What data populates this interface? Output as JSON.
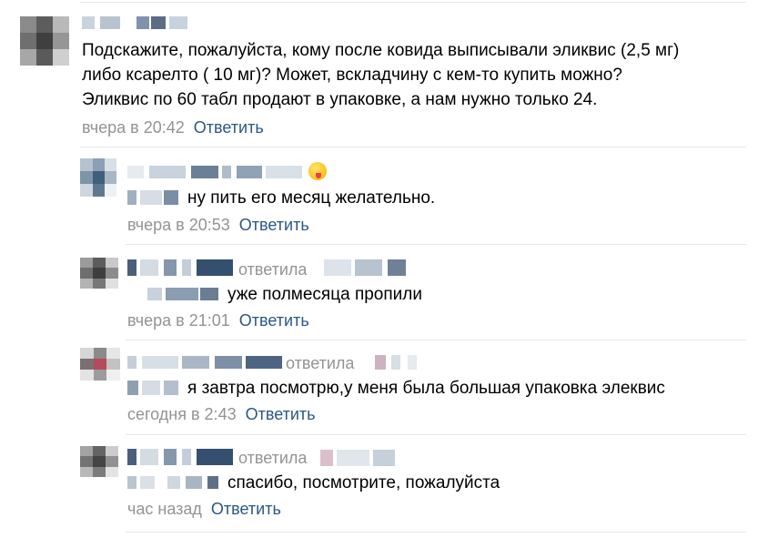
{
  "comments": [
    {
      "text_lines": [
        "Подскажите, пожалуйста, кому после ковида выписывали эликвис (2,5 мг)",
        "либо ксарелто ( 10 мг)? Может, вскладчину с кем-то купить можно?",
        "Эликвис по 60 табл продают в упаковке, а нам нужно только 24."
      ],
      "time": "вчера в 20:42",
      "reply_label": "Ответить"
    },
    {
      "text": "ну пить его месяц желательно.",
      "time": "вчера в 20:53",
      "reply_label": "Ответить"
    },
    {
      "replied_label": "ответила",
      "text": "уже полмесяца пропили",
      "time": "вчера в 21:01",
      "reply_label": "Ответить"
    },
    {
      "replied_label": "ответила",
      "text": "я завтра посмотрю,у меня была большая упаковка элеквис",
      "time": "сегодня в 2:43",
      "reply_label": "Ответить"
    },
    {
      "replied_label": "ответила",
      "text": "спасибо, посмотрите, пожалуйста",
      "time": "час назад",
      "reply_label": "Ответить"
    }
  ],
  "colors": {
    "text": "#000000",
    "meta": "#939393",
    "link": "#2a5885",
    "divider": "#e7e8ec"
  }
}
